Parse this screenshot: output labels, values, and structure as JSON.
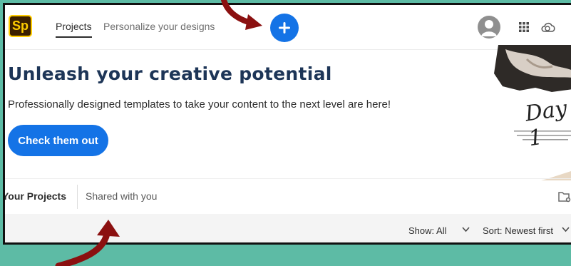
{
  "header": {
    "logo_text": "Sp",
    "nav": [
      {
        "label": "Projects",
        "active": true
      },
      {
        "label": "Personalize your designs",
        "active": false
      }
    ],
    "icons": [
      "plus-icon",
      "avatar-icon",
      "apps-grid-icon",
      "creative-cloud-icon"
    ]
  },
  "hero": {
    "title": "Unleash your creative potential",
    "subtitle": "Professionally designed templates to take your content to the next level are here!",
    "cta_label": "Check them out",
    "promo_script": "Day 1"
  },
  "projects": {
    "tabs": [
      "Your Projects",
      "Shared with you"
    ],
    "filters": {
      "show": "Show: All",
      "sort": "Sort: Newest first"
    }
  },
  "colors": {
    "background": "#5dbba5",
    "accent": "#1473e6",
    "title": "#1d3557",
    "arrow": "#8b1010"
  }
}
